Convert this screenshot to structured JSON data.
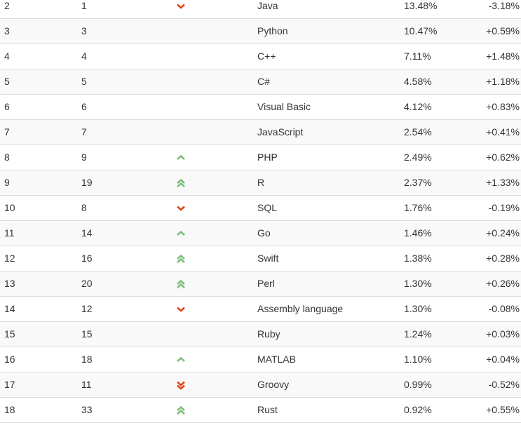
{
  "colors": {
    "up": "#7cbf7c",
    "down": "#e2441a",
    "text": "#333333"
  },
  "rows": [
    [
      "2",
      "1",
      "down",
      "Java",
      "13.48%",
      "-3.18%"
    ],
    [
      "3",
      "3",
      "",
      "Python",
      "10.47%",
      "+0.59%"
    ],
    [
      "4",
      "4",
      "",
      "C++",
      "7.11%",
      "+1.48%"
    ],
    [
      "5",
      "5",
      "",
      "C#",
      "4.58%",
      "+1.18%"
    ],
    [
      "6",
      "6",
      "",
      "Visual Basic",
      "4.12%",
      "+0.83%"
    ],
    [
      "7",
      "7",
      "",
      "JavaScript",
      "2.54%",
      "+0.41%"
    ],
    [
      "8",
      "9",
      "up",
      "PHP",
      "2.49%",
      "+0.62%"
    ],
    [
      "9",
      "19",
      "up-double",
      "R",
      "2.37%",
      "+1.33%"
    ],
    [
      "10",
      "8",
      "down",
      "SQL",
      "1.76%",
      "-0.19%"
    ],
    [
      "11",
      "14",
      "up",
      "Go",
      "1.46%",
      "+0.24%"
    ],
    [
      "12",
      "16",
      "up-double",
      "Swift",
      "1.38%",
      "+0.28%"
    ],
    [
      "13",
      "20",
      "up-double",
      "Perl",
      "1.30%",
      "+0.26%"
    ],
    [
      "14",
      "12",
      "down",
      "Assembly language",
      "1.30%",
      "-0.08%"
    ],
    [
      "15",
      "15",
      "",
      "Ruby",
      "1.24%",
      "+0.03%"
    ],
    [
      "16",
      "18",
      "up",
      "MATLAB",
      "1.10%",
      "+0.04%"
    ],
    [
      "17",
      "11",
      "down-double",
      "Groovy",
      "0.99%",
      "-0.52%"
    ],
    [
      "18",
      "33",
      "up-double",
      "Rust",
      "0.92%",
      "+0.55%"
    ]
  ]
}
